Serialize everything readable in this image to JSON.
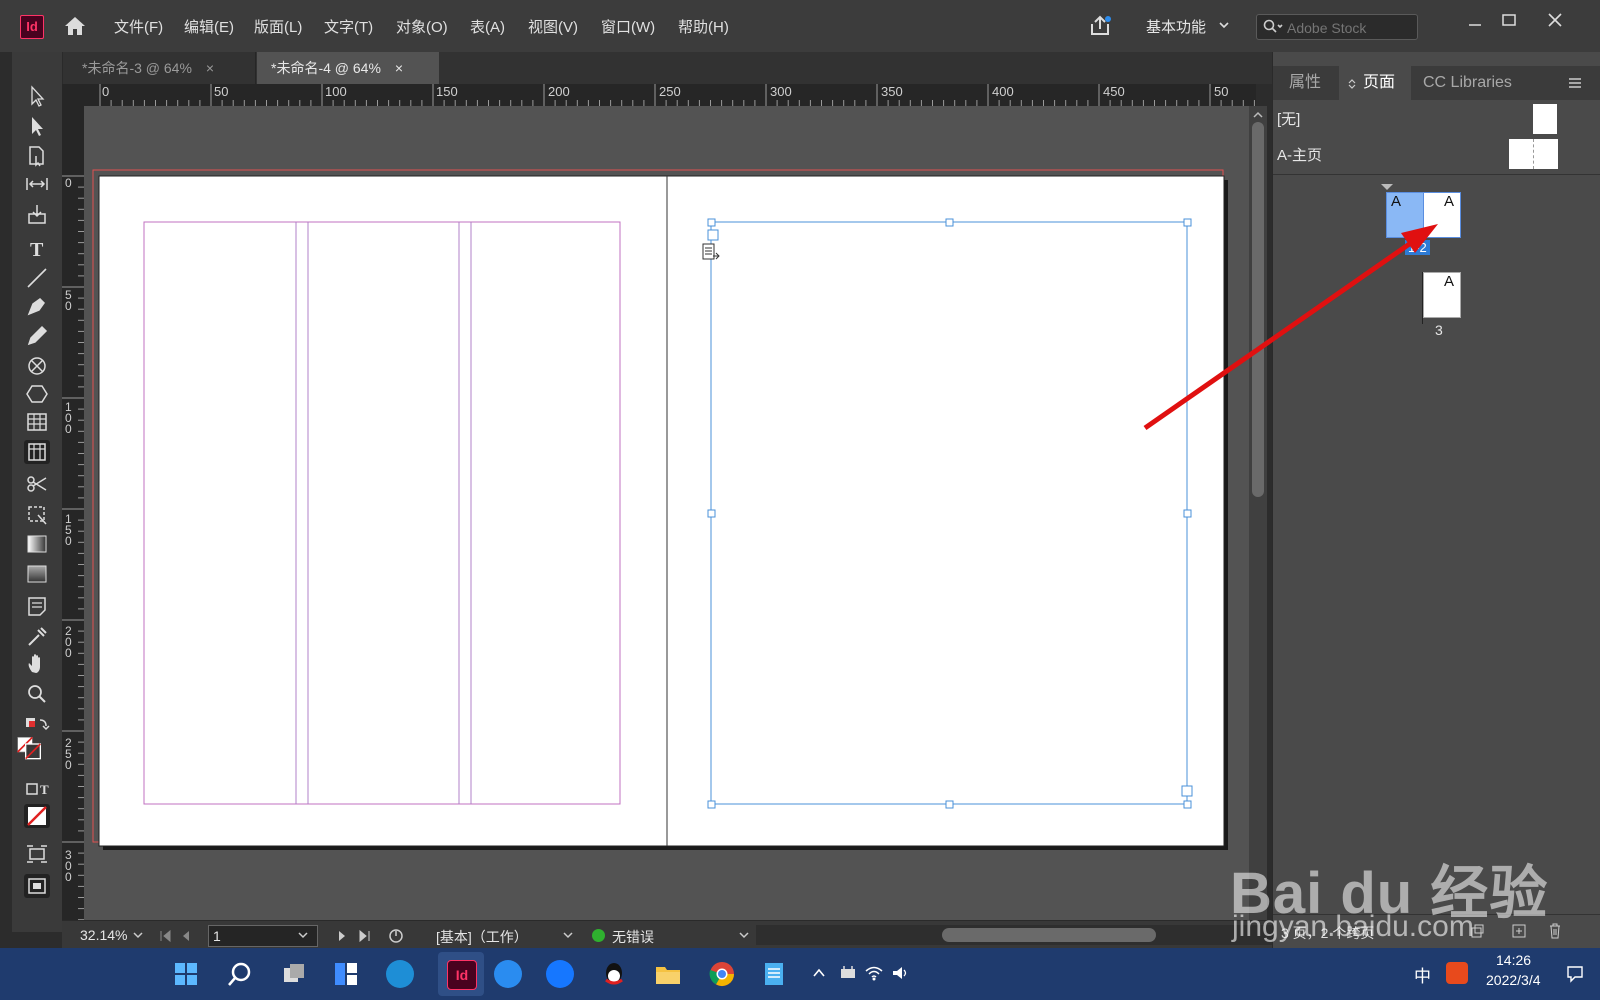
{
  "menubar": {
    "logo": "Id",
    "menus": [
      "文件(F)",
      "编辑(E)",
      "版面(L)",
      "文字(T)",
      "对象(O)",
      "表(A)",
      "视图(V)",
      "窗口(W)",
      "帮助(H)"
    ],
    "workspace": "基本功能",
    "search_placeholder": "Adobe Stock"
  },
  "tabs": [
    {
      "label": "*未命名-3 @ 64%",
      "close": "×"
    },
    {
      "label": "*未命名-4 @ 64%",
      "close": "×"
    }
  ],
  "ruler": {
    "h_labels": [
      "0",
      "50",
      "100",
      "150",
      "200",
      "250",
      "300",
      "350",
      "400",
      "450",
      "50"
    ],
    "v_labels": [
      "0",
      "5 0",
      "1 0 0",
      "1 5 0",
      "2 0 0",
      "2 5 0",
      "3 0 0"
    ]
  },
  "statusbar": {
    "zoom": "32.14%",
    "page": "1",
    "profile": "[基本]（工作）",
    "errors": "无错误"
  },
  "panel": {
    "tabs": [
      "属性",
      "页面",
      "CC Libraries"
    ],
    "masters": [
      "[无]",
      "A-主页"
    ],
    "spread_label": "1-2",
    "page3_label": "3",
    "page_master_letter": "A",
    "summary": "3 页，2 个跨页"
  },
  "taskbar": {
    "time": "14:26",
    "date": "2022/3/4",
    "ime": "中"
  },
  "watermark": {
    "brand": "Bai du 经验",
    "url": "jingyan.baidu.com"
  },
  "colors": {
    "accent_blue": "#4a90d9",
    "selection_blue": "#77aaff",
    "arrow_red": "#e01010",
    "margin_magenta": "#c070c0",
    "bleed_red": "#e05050"
  }
}
